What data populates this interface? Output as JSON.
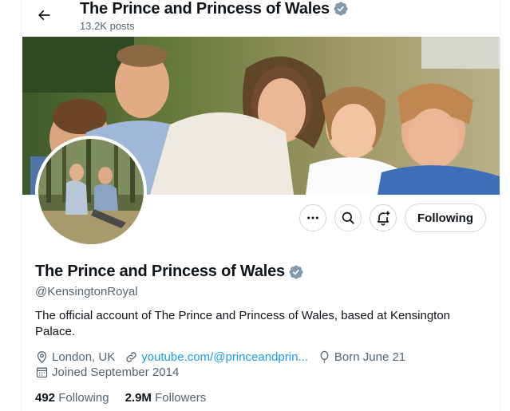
{
  "header": {
    "title": "The Prince and Princess of Wales",
    "posts": "13.2K posts"
  },
  "profile": {
    "display_name": "The Prince and Princess of Wales",
    "handle": "@KensingtonRoyal",
    "bio": "The official account of The Prince and Princess of Wales, based at Kensington Palace.",
    "location": "London, UK",
    "website": "youtube.com/@princeandprin...",
    "birthday": "Born June 21",
    "joined": "Joined September 2014",
    "following_count": "492",
    "following_label": "Following",
    "followers_count": "2.9M",
    "followers_label": "Followers"
  },
  "actions": {
    "more_icon": "more-icon",
    "search_icon": "search-icon",
    "notify_icon": "bell-plus-icon",
    "follow_label": "Following"
  },
  "colors": {
    "accent": "#1d9bf0",
    "verified_badge": "#829aab",
    "secondary_text": "#536471"
  }
}
